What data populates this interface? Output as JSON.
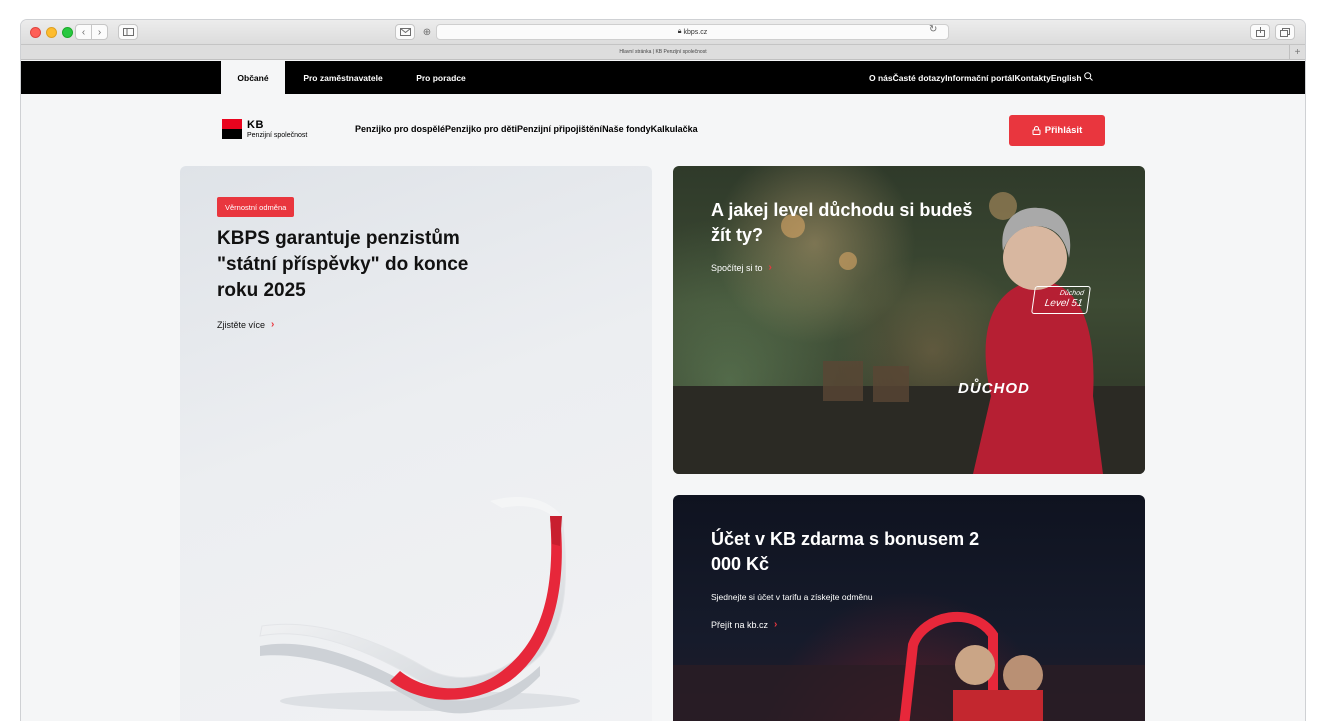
{
  "browser": {
    "url": "kbps.cz",
    "tab_title": "Hlavní stránka | KB Penzijní společnost"
  },
  "topnav": {
    "segments": [
      {
        "label": "Občané",
        "active": true
      },
      {
        "label": "Pro zaměstnavatele",
        "active": false
      },
      {
        "label": "Pro poradce",
        "active": false
      }
    ],
    "utility": [
      "O nás",
      "Časté dotazy",
      "Informační portál",
      "Kontakty",
      "English"
    ]
  },
  "logo": {
    "brand": "KB",
    "subtitle": "Penzijní společnost"
  },
  "menu": [
    "Penzijko pro dospělé",
    "Penzijko pro děti",
    "Penzijní připojištění",
    "Naše fondy",
    "Kalkulačka"
  ],
  "login_label": "Přihlásit",
  "left_card": {
    "badge": "Věrnostní odměna",
    "title": "KBPS garantuje penzistům \"státní příspěvky\" do konce roku 2025",
    "link": "Zjistěte více"
  },
  "top_right_card": {
    "title": "A jakej level důchodu si budeš žít ty?",
    "link": "Spočítej si to",
    "tag_line1": "Důchod",
    "tag_line2": "Level 51",
    "hoodie": "DŮCHOD"
  },
  "bottom_right_card": {
    "title": "Účet v KB zdarma s bonusem 2 000 Kč",
    "subtitle": "Sjednejte si účet v tarifu a získejte odměnu",
    "link": "Přejít na kb.cz"
  },
  "colors": {
    "brand_red": "#e9363e",
    "kb_red": "#e9041e",
    "black": "#000000"
  }
}
